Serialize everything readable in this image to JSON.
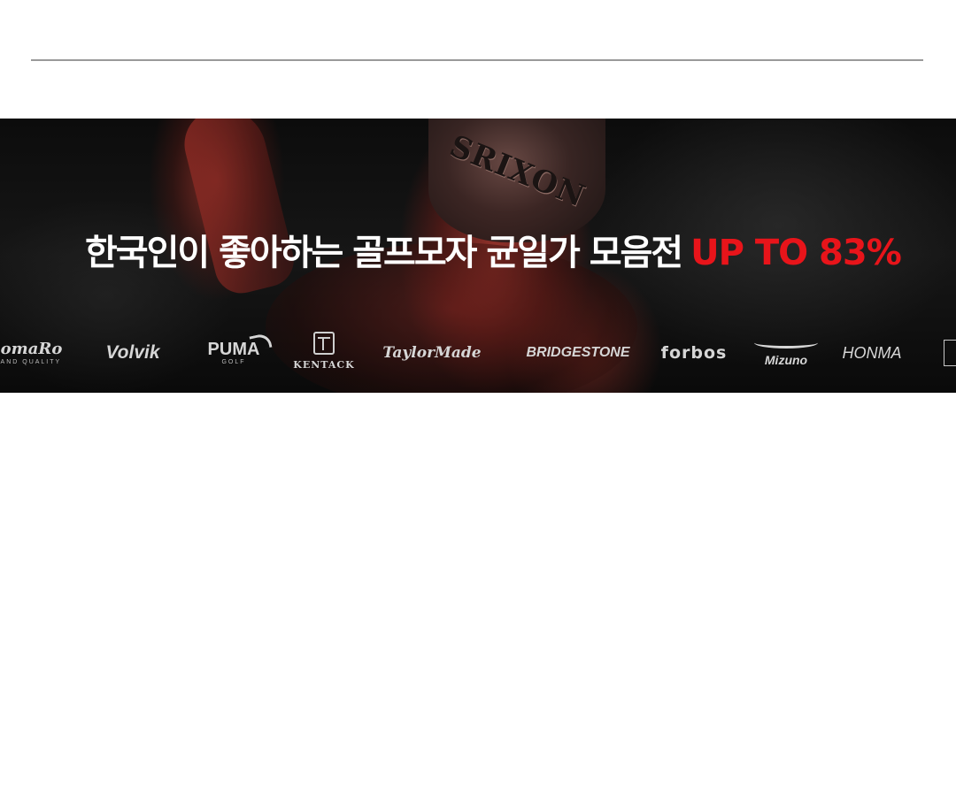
{
  "banner": {
    "cap_brand": "SRIXON",
    "headline_main": "한국인이 좋아하는 골프모자 균일가 모음전",
    "headline_accent": "UP TO 83%",
    "accent_color": "#e8141a"
  },
  "brands": [
    {
      "name": "RomaRo",
      "sub": "BRAND QUALITY"
    },
    {
      "name": "Volvik"
    },
    {
      "name": "PUMA",
      "sub": "GOLF"
    },
    {
      "name": "KENTACK"
    },
    {
      "name": "TaylorMade"
    },
    {
      "name": "BRIDGESTONE"
    },
    {
      "name": "forbos"
    },
    {
      "name": "Mizuno"
    },
    {
      "name": "HONMA"
    }
  ]
}
